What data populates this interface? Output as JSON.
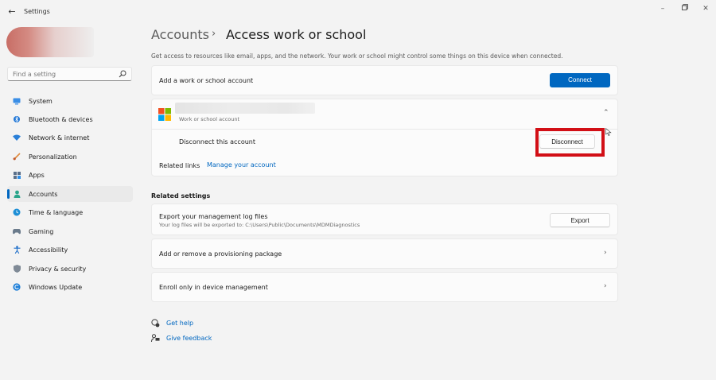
{
  "window": {
    "title": "Settings",
    "back_icon": "back-arrow-icon",
    "controls": [
      "minimize-icon",
      "restore-icon",
      "close-icon"
    ]
  },
  "search": {
    "placeholder": "Find a setting",
    "icon": "search-icon"
  },
  "sidebar": {
    "items": [
      {
        "label": "System",
        "icon": "system-icon",
        "active": false
      },
      {
        "label": "Bluetooth & devices",
        "icon": "bluetooth-icon",
        "active": false
      },
      {
        "label": "Network & internet",
        "icon": "wifi-icon",
        "active": false
      },
      {
        "label": "Personalization",
        "icon": "brush-icon",
        "active": false
      },
      {
        "label": "Apps",
        "icon": "apps-icon",
        "active": false
      },
      {
        "label": "Accounts",
        "icon": "person-icon",
        "active": true
      },
      {
        "label": "Time & language",
        "icon": "globe-clock-icon",
        "active": false
      },
      {
        "label": "Gaming",
        "icon": "gamepad-icon",
        "active": false
      },
      {
        "label": "Accessibility",
        "icon": "accessibility-icon",
        "active": false
      },
      {
        "label": "Privacy & security",
        "icon": "shield-icon",
        "active": false
      },
      {
        "label": "Windows Update",
        "icon": "update-icon",
        "active": false
      }
    ]
  },
  "breadcrumb": {
    "parent": "Accounts",
    "separator": "›",
    "current": "Access work or school"
  },
  "description": "Get access to resources like email, apps, and the network. Your work or school might control some things on this device when connected.",
  "add_account": {
    "label": "Add a work or school account",
    "button": "Connect"
  },
  "account": {
    "icon": "microsoft-logo-icon",
    "subtitle": "Work or school account",
    "disconnect_label": "Disconnect this account",
    "disconnect_button": "Disconnect",
    "related_links_label": "Related links",
    "manage_link": "Manage your account"
  },
  "related_settings": {
    "title": "Related settings",
    "export": {
      "label": "Export your management log files",
      "sublabel": "Your log files will be exported to: C:\\Users\\Public\\Documents\\MDMDiagnostics",
      "button": "Export"
    },
    "provisioning": {
      "label": "Add or remove a provisioning package"
    },
    "enroll": {
      "label": "Enroll only in device management"
    }
  },
  "help": {
    "get_help": "Get help",
    "give_feedback": "Give feedback"
  },
  "colors": {
    "accent": "#0067c0",
    "highlight_box": "#d20f16"
  }
}
